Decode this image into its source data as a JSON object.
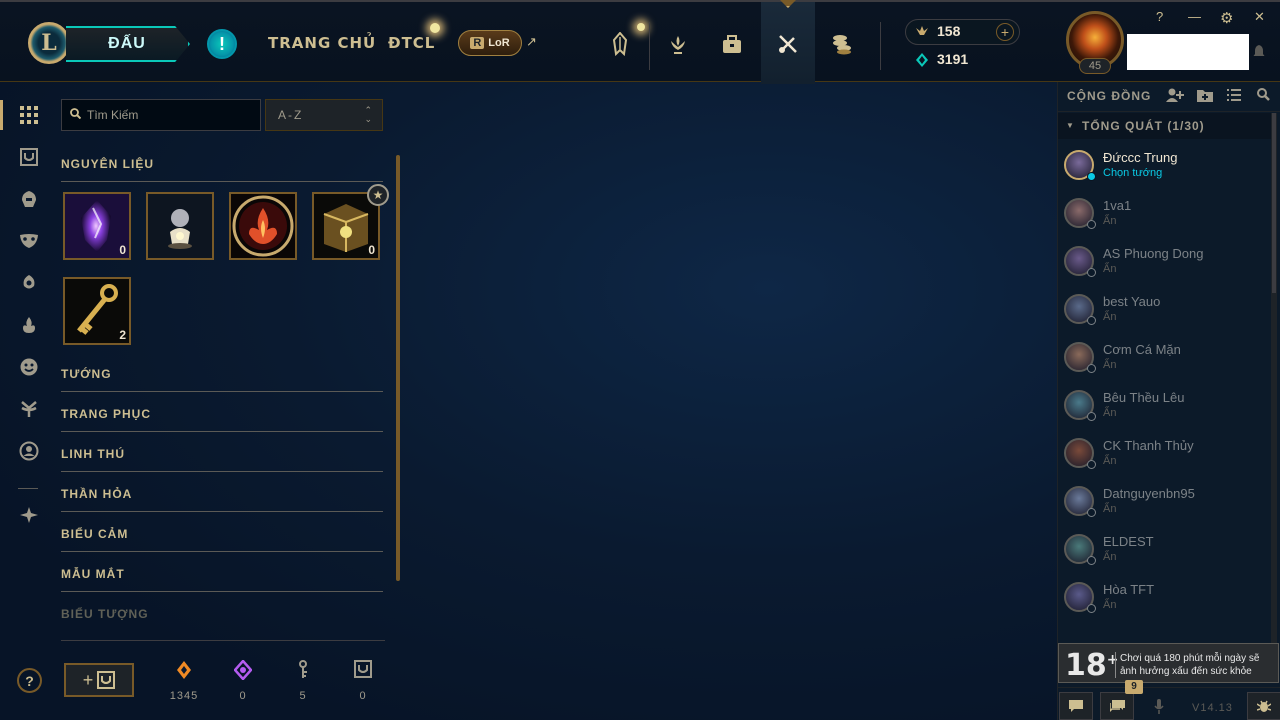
{
  "topbar": {
    "logo_letter": "L",
    "play_label": "ĐẤU",
    "alert_label": "!",
    "nav": [
      "TRANG CHỦ",
      "ĐTCL"
    ],
    "lor_label": "LoR",
    "lor_badge": "R",
    "external_icon": "↗",
    "icons": [
      "crystal-icon",
      "trophy-icon",
      "collection-icon",
      "loot-icon",
      "store-icon"
    ],
    "rp": "158",
    "be": "3191",
    "level": "45",
    "window": {
      "help": "?",
      "minimize": "—",
      "settings": "⚙",
      "close": "✕"
    }
  },
  "inventory": {
    "search_placeholder": "Tìm Kiếm",
    "sort_label": "A-Z",
    "sections": {
      "materials": "NGUYÊN LIỆU",
      "champions": "TƯỚNG",
      "skins": "TRANG PHỤC",
      "companions": "LINH THÚ",
      "wards": "THẦN HỎA",
      "emotes": "BIỂU CẢM",
      "eye_color": "MẪU MẮT",
      "icons": "BIỂU TƯỢNG"
    },
    "materials": [
      {
        "name": "mythic-essence-icon",
        "count": "0"
      },
      {
        "name": "orb-icon",
        "count": ""
      },
      {
        "name": "hextech-flame-icon",
        "count": ""
      },
      {
        "name": "chest-icon",
        "count": "0"
      },
      {
        "name": "key-icon",
        "count": "2"
      }
    ],
    "stats": [
      {
        "icon": "orange-essence-icon",
        "value": "1345",
        "color": "#f08a24"
      },
      {
        "icon": "mythic-essence-icon",
        "value": "0",
        "color": "#b45cf0"
      },
      {
        "icon": "key-fragment-icon",
        "value": "5",
        "color": "#a09b8c"
      },
      {
        "icon": "chest-icon",
        "value": "0",
        "color": "#a09b8c"
      }
    ]
  },
  "social": {
    "title": "CỘNG ĐỒNG",
    "group": "TỔNG QUÁT (1/30)",
    "friends": [
      {
        "name": "Đứccc Trung",
        "status": "Chọn tướng",
        "online": true
      },
      {
        "name": "1va1",
        "status": "Ẩn"
      },
      {
        "name": "AS Phuong Dong",
        "status": "Ẩn"
      },
      {
        "name": "best Yauo",
        "status": "Ẩn"
      },
      {
        "name": "Cơm Cá Mặn",
        "status": "Ẩn"
      },
      {
        "name": "Bêu Thều Lêu",
        "status": "Ẩn"
      },
      {
        "name": "CK Thanh Thủy",
        "status": "Ẩn"
      },
      {
        "name": "Datnguyenbn95",
        "status": "Ẩn"
      },
      {
        "name": "ELDEST",
        "status": "Ẩn"
      },
      {
        "name": "Hòa TFT",
        "status": "Ẩn"
      }
    ],
    "age_rating": "18",
    "age_plus": "+",
    "age_message": "Chơi quá 180 phút mỗi ngày sẽ ảnh hưởng xấu đến sức khỏe",
    "badge_count": "9",
    "version": "V14.13"
  },
  "colors": {
    "gold": "#c8aa6e",
    "teal": "#0ac8b9",
    "online": "#0acbe6"
  }
}
